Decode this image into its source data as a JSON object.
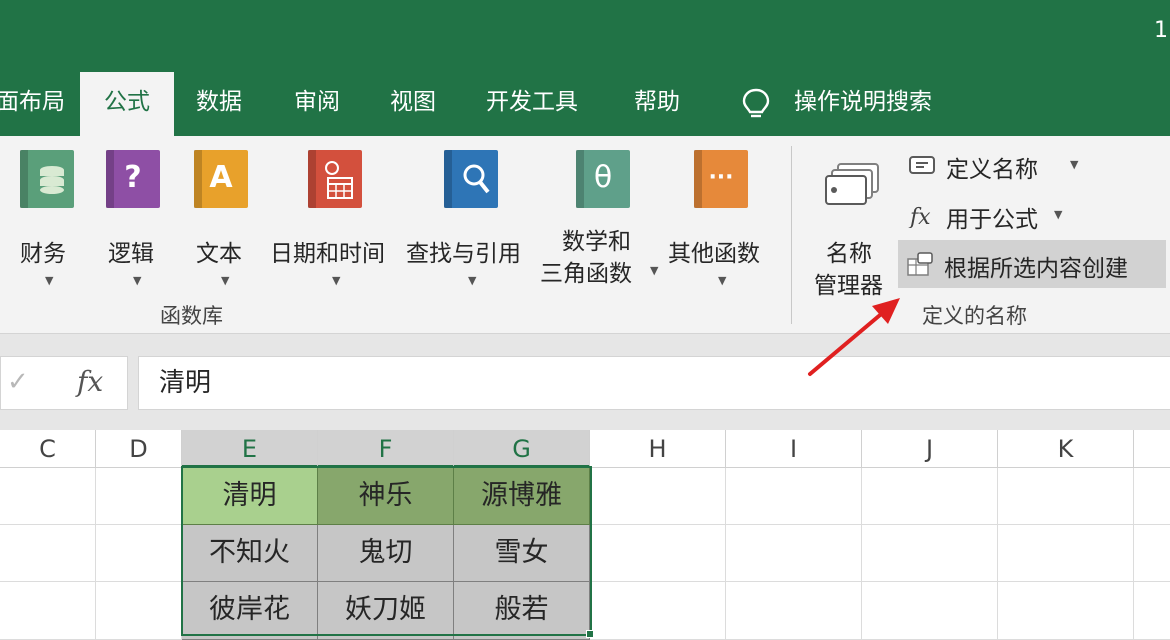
{
  "title_bar": {
    "text": "1"
  },
  "tabs": [
    {
      "label": "面布局"
    },
    {
      "label": "公式"
    },
    {
      "label": "数据"
    },
    {
      "label": "审阅"
    },
    {
      "label": "视图"
    },
    {
      "label": "开发工具"
    },
    {
      "label": "帮助"
    },
    {
      "label": "操作说明搜索"
    }
  ],
  "ribbon": {
    "function_library": {
      "group_label": "函数库",
      "buttons": [
        {
          "label": "财务",
          "icon": "financial-book-icon",
          "color": "#5a9f7a"
        },
        {
          "label": "逻辑",
          "icon": "logical-book-icon",
          "glyph": "?",
          "color": "#8e4fa5"
        },
        {
          "label": "文本",
          "icon": "text-book-icon",
          "glyph": "A",
          "color": "#e8a12b"
        },
        {
          "label": "日期和时间",
          "icon": "date-time-book-icon",
          "color": "#d3503d"
        },
        {
          "label": "查找与引用",
          "icon": "lookup-book-icon",
          "color": "#2e75b6"
        },
        {
          "label1": "数学和",
          "label2": "三角函数",
          "icon": "math-book-icon",
          "glyph": "θ",
          "color": "#5fa08a"
        },
        {
          "label": "其他函数",
          "icon": "more-functions-book-icon",
          "glyph": "···",
          "color": "#e6893a"
        }
      ]
    },
    "defined_names": {
      "group_label": "定义的名称",
      "name_manager": {
        "label1": "名称",
        "label2": "管理器"
      },
      "define_name": "定义名称",
      "use_in_formula": "用于公式",
      "create_from_selection": "根据所选内容创建"
    }
  },
  "formula_bar": {
    "fx": "fx",
    "value": "清明"
  },
  "grid": {
    "columns": [
      "C",
      "D",
      "E",
      "F",
      "G",
      "H",
      "I",
      "J",
      "K"
    ],
    "rows": [
      [
        "清明",
        "神乐",
        "源博雅"
      ],
      [
        "不知火",
        "鬼切",
        "雪女"
      ],
      [
        "彼岸花",
        "妖刀姬",
        "般若"
      ]
    ]
  },
  "colors": {
    "excel_green": "#217346",
    "annotation_arrow": "#e02020"
  }
}
